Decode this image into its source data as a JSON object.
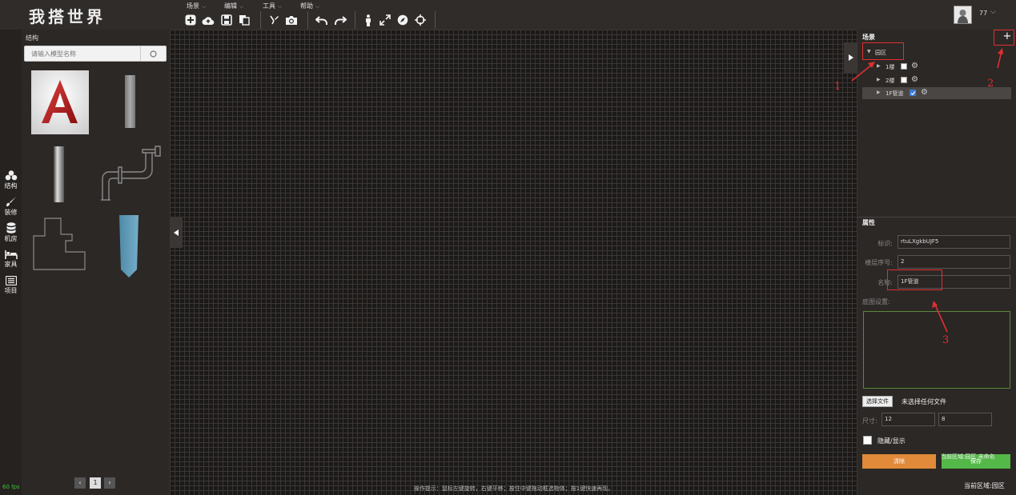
{
  "app": {
    "logo": "我搭世界"
  },
  "menu": [
    {
      "label": "场景"
    },
    {
      "label": "编辑"
    },
    {
      "label": "工具"
    },
    {
      "label": "帮助"
    }
  ],
  "toolbar": {
    "icons": [
      "add-icon",
      "cloud-upload-icon",
      "save-icon",
      "copy-icon",
      "brush-icon",
      "camera-icon",
      "undo-icon",
      "redo-icon",
      "person-icon",
      "fullscreen-icon",
      "compass-icon",
      "center-icon"
    ]
  },
  "user": {
    "name": "77"
  },
  "rail": [
    {
      "label": "结构",
      "icon": "structure-icon"
    },
    {
      "label": "装修",
      "icon": "brush-icon"
    },
    {
      "label": "机房",
      "icon": "database-icon"
    },
    {
      "label": "家具",
      "icon": "bed-icon"
    },
    {
      "label": "项目",
      "icon": "list-icon"
    }
  ],
  "fps": "60 fps",
  "library": {
    "title": "结构",
    "search_placeholder": "请输入模型名称",
    "page": "1"
  },
  "canvas": {
    "hint": "操作提示：鼠标左键旋转，右键平移；按住中键拖动框选物体；按1键快速再现。"
  },
  "scene": {
    "title": "场景",
    "add": "+",
    "tree": [
      {
        "label": "园区",
        "level": 0,
        "expanded": true
      },
      {
        "label": "1楼",
        "level": 1,
        "checked": false
      },
      {
        "label": "2楼",
        "level": 1,
        "checked": false
      },
      {
        "label": "1F管道",
        "level": 1,
        "checked": true,
        "selected": true
      }
    ]
  },
  "properties": {
    "title": "属性",
    "id_label": "标识:",
    "id_value": "rtuLXgkbUJF5",
    "floor_index_label": "楼层序号:",
    "floor_index_value": "2",
    "name_label": "名称:",
    "name_value": "1F管道",
    "floorplan_label": "底图设置:",
    "file_button": "选择文件",
    "file_status": "未选择任何文件",
    "size_label": "尺寸:",
    "size_w": "12",
    "size_h": "8",
    "hide_label": "隐藏/显示",
    "clear_button": "清除",
    "save_button": "保存",
    "save_overlay": "当前区域:园区 未命名",
    "current_zone": "当前区域:园区"
  },
  "annotations": {
    "n1": "1",
    "n2": "2",
    "n3": "3"
  },
  "colors": {
    "accent_red": "#e03030",
    "orange": "#e08a3a",
    "green": "#54b848"
  }
}
